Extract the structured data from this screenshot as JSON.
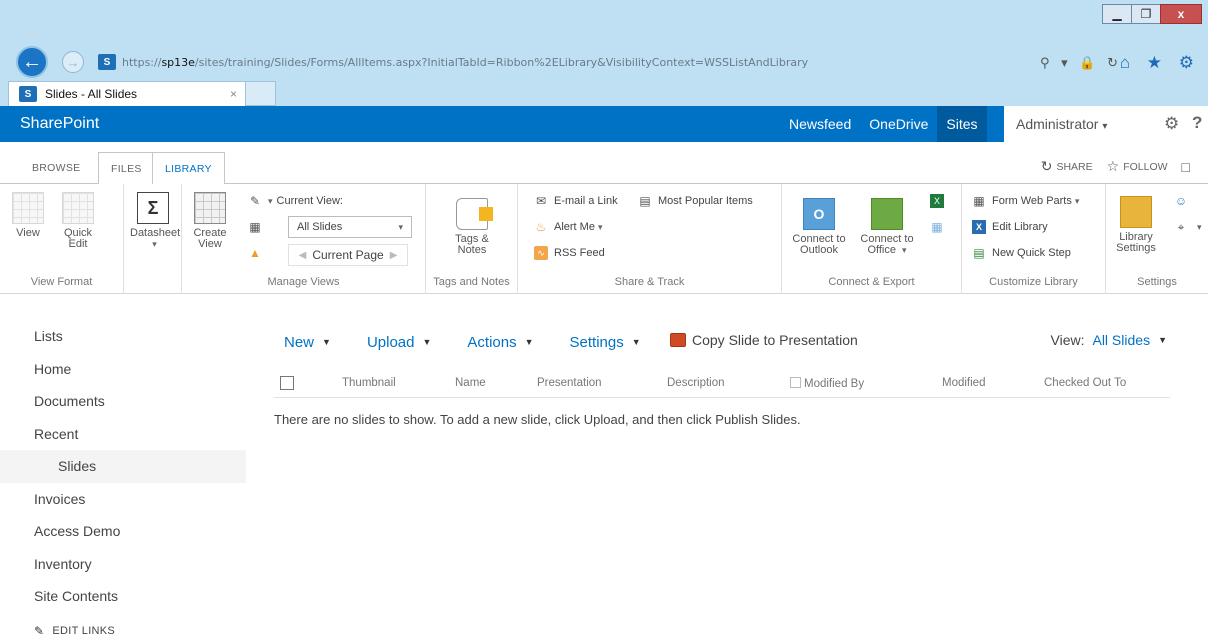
{
  "browser": {
    "url_prefix": "https://",
    "url_host": "sp13e",
    "url_path": "/sites/training/Slides/Forms/AllItems.aspx?InitialTabId=Ribbon%2ELibrary&VisibilityContext=WSSListAndLibrary",
    "tab_title": "Slides - All Slides",
    "tab_close": "×",
    "window_buttons": {
      "minimize": "▁",
      "restore": "❐",
      "close": "x"
    },
    "address_icons": "⚲ ▾ 🔒 ↻",
    "tool_icons": "⌂ ★ ⚙"
  },
  "suite": {
    "brand": "SharePoint",
    "links": [
      "Newsfeed",
      "OneDrive",
      "Sites"
    ],
    "active_link": "Sites",
    "user": "Administrator",
    "user_caret": "▾",
    "help": "?"
  },
  "ribbon_tabs": {
    "browse": "BROWSE",
    "files": "FILES",
    "library": "LIBRARY",
    "share": "SHARE",
    "follow": "FOLLOW"
  },
  "ribbon": {
    "view_format": {
      "label": "View Format",
      "view": "View",
      "quick_edit_1": "Quick",
      "quick_edit_2": "Edit"
    },
    "datasheet": {
      "label": "Datasheet"
    },
    "manage_views": {
      "label": "Manage Views",
      "create_view_1": "Create",
      "create_view_2": "View",
      "current_view": "Current View:",
      "selected_view": "All Slides",
      "current_page": "Current Page"
    },
    "tags_notes": {
      "label": "Tags and Notes",
      "btn_1": "Tags &",
      "btn_2": "Notes"
    },
    "share_track": {
      "label": "Share & Track",
      "email_link": "E-mail a Link",
      "alert_me": "Alert Me",
      "rss_feed": "RSS Feed",
      "most_popular": "Most Popular Items"
    },
    "connect_export": {
      "label": "Connect & Export",
      "outlook_1": "Connect to",
      "outlook_2": "Outlook",
      "office_1": "Connect to",
      "office_2": "Office"
    },
    "customize": {
      "label": "Customize Library",
      "form_web_parts": "Form Web Parts",
      "edit_library": "Edit Library",
      "new_quick_step": "New Quick Step"
    },
    "settings": {
      "label": "Settings",
      "lib_settings_1": "Library",
      "lib_settings_2": "Settings"
    }
  },
  "leftnav": {
    "items": [
      "Lists",
      "Home",
      "Documents",
      "Recent",
      "Slides",
      "Invoices",
      "Access Demo",
      "Inventory",
      "Site Contents"
    ],
    "edit_links": "EDIT LINKS"
  },
  "toolbar": {
    "new": "New",
    "upload": "Upload",
    "actions": "Actions",
    "settings": "Settings",
    "copy_slide": "Copy Slide to Presentation",
    "view_label": "View:",
    "view_value": "All Slides"
  },
  "list": {
    "columns": [
      "Thumbnail",
      "Name",
      "Presentation",
      "Description",
      "Modified By",
      "Modified",
      "Checked Out To"
    ],
    "empty_message": "There are no slides to show. To add a new slide, click Upload, and then click Publish Slides."
  }
}
